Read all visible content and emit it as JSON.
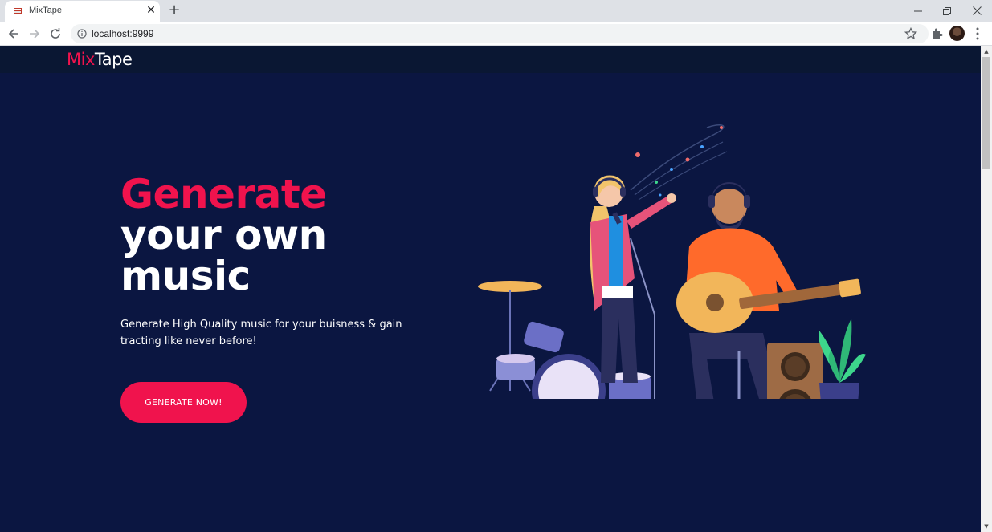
{
  "browser": {
    "tab_title": "MixTape",
    "new_tab_symbol": "+",
    "close_symbol": "✕",
    "url": "localhost:9999",
    "icons": [
      "back-icon",
      "forward-icon",
      "reload-icon",
      "info-icon",
      "star-icon",
      "extensions-icon",
      "profile-avatar",
      "menu-icon"
    ]
  },
  "site": {
    "logo_mix": "Mix",
    "logo_tape": "Tape",
    "hero_line1": "Generate",
    "hero_line2": "your own",
    "hero_line3": "music",
    "subtitle": "Generate High Quality music for your buisness & gain tracting like never before!",
    "cta_label": "GENERATE NOW!",
    "colors": {
      "background": "#0b1641",
      "header": "#0a1733",
      "accent": "#f0134d",
      "text": "#ffffff"
    }
  }
}
